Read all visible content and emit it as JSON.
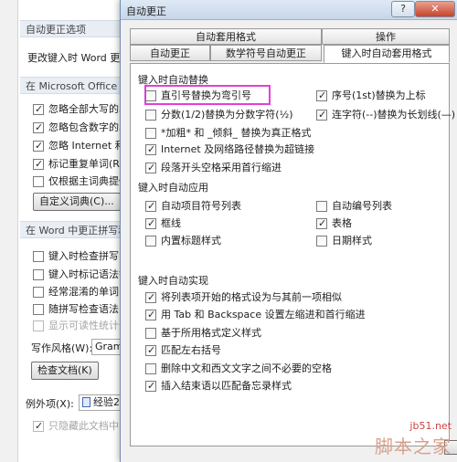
{
  "background": {
    "sections": [
      "自动更正选项",
      "在 Microsoft Office 中",
      "在 Word 中更正拼写和"
    ],
    "autocorrect_row": "更改键入时 Word 更",
    "office_options": [
      {
        "label": "忽略全部大写的单",
        "checked": true
      },
      {
        "label": "忽略包含数字的单",
        "checked": true
      },
      {
        "label": "忽略 Internet 和文",
        "checked": true
      },
      {
        "label": "标记重复单词(R)",
        "checked": true
      },
      {
        "label": "仅根据主词典提供",
        "checked": false
      }
    ],
    "custom_dict_button": "自定义词典(C)...",
    "word_options": [
      {
        "label": "键入时检查拼写(P)",
        "checked": false
      },
      {
        "label": "键入时标记语法错",
        "checked": false
      },
      {
        "label": "经常混淆的单词(N)",
        "checked": false
      },
      {
        "label": "随拼写检查语法(H",
        "checked": false
      },
      {
        "label": "显示可读性统计信",
        "checked": false,
        "disabled": true
      }
    ],
    "writing_style_label": "写作风格(W):",
    "writing_style_value": "Gram",
    "check_doc_button": "检查文档(K)",
    "exceptions_label": "例外项(X):",
    "exceptions_value": "经验2",
    "hide_errors": "只隐藏此文档中的"
  },
  "dialog": {
    "title": "自动更正",
    "help": "?",
    "close": "✕",
    "tabs_row1": [
      "自动套用格式",
      "操作"
    ],
    "tabs_row2": [
      "自动更正",
      "数学符号自动更正",
      "键入时自动套用格式"
    ],
    "groups": {
      "replace_title": "键入时自动替换",
      "apply_title": "键入时自动应用",
      "auto_title": "键入时自动实现"
    },
    "replace_left": [
      {
        "label": "直引号替换为弯引号",
        "checked": false
      },
      {
        "label": "分数(1/2)替换为分数字符(½)",
        "checked": false
      },
      {
        "label": "*加粗* 和 _倾斜_ 替换为真正格式",
        "checked": false
      },
      {
        "label": "Internet 及网络路径替换为超链接",
        "checked": true
      },
      {
        "label": "段落开头空格采用首行缩进",
        "checked": true
      }
    ],
    "replace_right": [
      {
        "label": "序号(1st)替换为上标",
        "checked": true
      },
      {
        "label": "连字符(--)替换为长划线(—)",
        "checked": true
      }
    ],
    "apply_left": [
      {
        "label": "自动项目符号列表",
        "checked": true
      },
      {
        "label": "框线",
        "checked": true
      },
      {
        "label": "内置标题样式",
        "checked": false
      }
    ],
    "apply_right": [
      {
        "label": "自动编号列表",
        "checked": false
      },
      {
        "label": "表格",
        "checked": true
      },
      {
        "label": "日期样式",
        "checked": false
      }
    ],
    "auto_items": [
      {
        "label": "将列表项开始的格式设为与其前一项相似",
        "checked": true
      },
      {
        "label": "用 Tab 和 Backspace 设置左缩进和首行缩进",
        "checked": true
      },
      {
        "label": "基于所用格式定义样式",
        "checked": false
      },
      {
        "label": "匹配左右括号",
        "checked": true
      },
      {
        "label": "删除中文和西文文字之间不必要的空格",
        "checked": false
      },
      {
        "label": "插入结束语以匹配备忘录样式",
        "checked": true
      }
    ]
  },
  "watermark": {
    "url": "jb51.net",
    "name": "脚本之家"
  },
  "colors": {
    "highlight": "#e43fd4",
    "titlebar": "#c6d6ea",
    "close": "#c8432a"
  }
}
